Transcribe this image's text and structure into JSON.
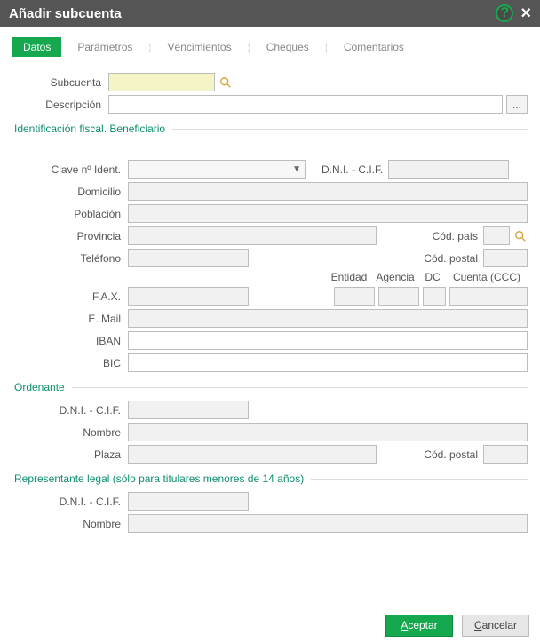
{
  "titlebar": {
    "title": "Añadir subcuenta"
  },
  "tabs": {
    "datos": {
      "pre": "",
      "ul": "D",
      "post": "atos"
    },
    "parametros": {
      "pre": "",
      "ul": "P",
      "post": "arámetros"
    },
    "vencimientos": {
      "pre": "",
      "ul": "V",
      "post": "encimientos"
    },
    "cheques": {
      "pre": "",
      "ul": "C",
      "post": "heques"
    },
    "comentarios": {
      "pre": "C",
      "ul": "o",
      "post": "mentarios"
    }
  },
  "labels": {
    "subcuenta": "Subcuenta",
    "descripcion": "Descripción",
    "clave": "Clave nº Ident.",
    "dni": "D.N.I. - C.I.F.",
    "domicilio": "Domicilio",
    "poblacion": "Población",
    "provincia": "Provincia",
    "codpais": "Cód. país",
    "telefono": "Teléfono",
    "codpostal": "Cód. postal",
    "fax": "F.A.X.",
    "entidad": "Entidad",
    "agencia": "Agencia",
    "dc": "DC",
    "cuenta": "Cuenta (CCC)",
    "email": "E. Mail",
    "iban": "IBAN",
    "bic": "BIC",
    "nombre": "Nombre",
    "plaza": "Plaza"
  },
  "sections": {
    "ident": "Identificación fiscal. Beneficiario",
    "ordenante": "Ordenante",
    "replegal": "Representante legal (sólo para titulares menores de 14 años)"
  },
  "values": {
    "subcuenta": "",
    "descripcion": "",
    "clave": "",
    "dni_ident": "",
    "domicilio": "",
    "poblacion": "",
    "provincia": "",
    "codpais": "",
    "telefono": "",
    "codpostal_ident": "",
    "fax": "",
    "email": "",
    "entidad": "",
    "agencia": "",
    "dc": "",
    "cuenta": "",
    "iban": "",
    "bic": "",
    "ord_dni": "",
    "ord_nombre": "",
    "ord_plaza": "",
    "ord_codpostal": "",
    "rep_dni": "",
    "rep_nombre": ""
  },
  "buttons": {
    "aceptar": {
      "pre": "",
      "ul": "A",
      "post": "ceptar"
    },
    "cancelar": {
      "pre": "",
      "ul": "C",
      "post": "ancelar"
    },
    "ellipsis": "..."
  }
}
